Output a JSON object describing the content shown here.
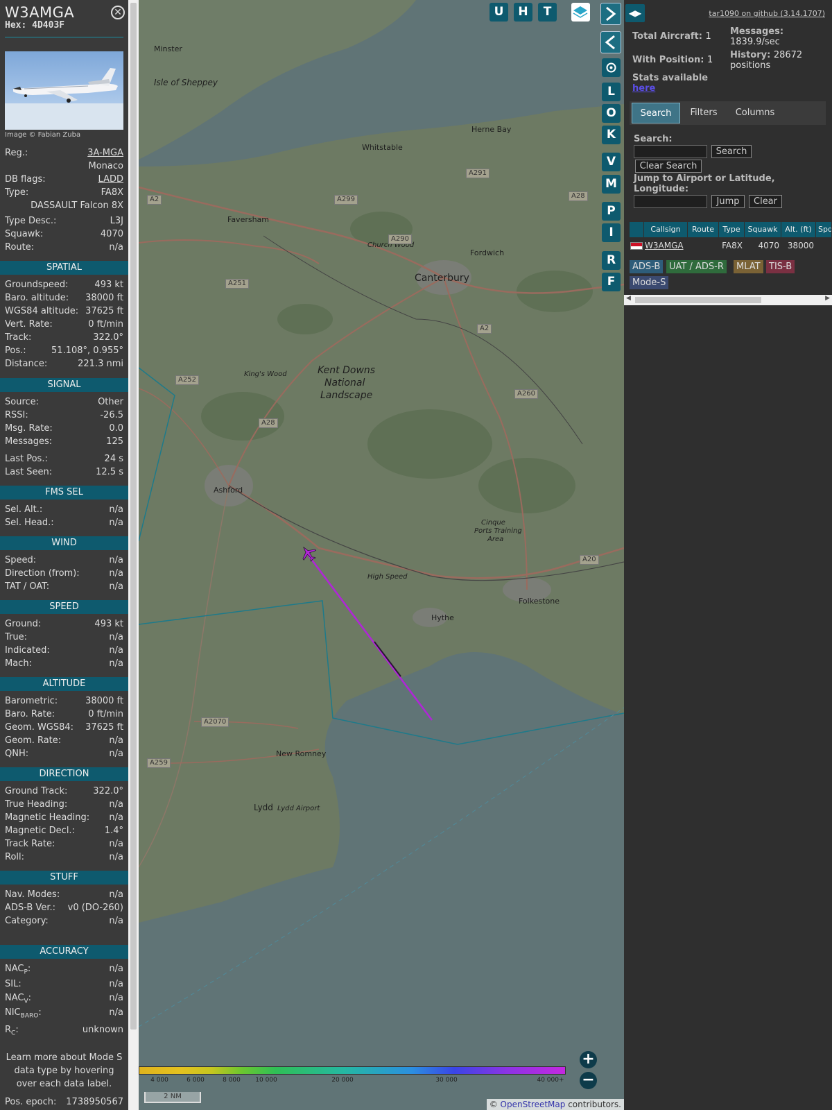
{
  "info": {
    "callsign": "W3AMGA",
    "hex": "Hex: 4D403F",
    "close_icon": "close-icon",
    "image_credit": "Image © Fabian Zuba",
    "reg_label": "Reg.:",
    "reg_value": "3A-MGA",
    "country": "Monaco",
    "dbflags_label": "DB flags:",
    "dbflags_value": "LADD",
    "type_label": "Type:",
    "type_value": "FA8X",
    "type_name": "DASSAULT Falcon 8X",
    "typedesc_label": "Type Desc.:",
    "typedesc_value": "L3J",
    "squawk_label": "Squawk:",
    "squawk_value": "4070",
    "route_label": "Route:",
    "route_value": "n/a"
  },
  "spatial": {
    "title": "SPATIAL",
    "rows": [
      {
        "k": "Groundspeed:",
        "v": "493 kt"
      },
      {
        "k": "Baro. altitude:",
        "v": "38000 ft"
      },
      {
        "k": "WGS84 altitude:",
        "v": "37625 ft"
      },
      {
        "k": "Vert. Rate:",
        "v": "0 ft/min"
      },
      {
        "k": "Track:",
        "v": "322.0°"
      },
      {
        "k": "Pos.:",
        "v": "51.108°, 0.955°"
      },
      {
        "k": "Distance:",
        "v": "221.3 nmi"
      }
    ]
  },
  "signal": {
    "title": "SIGNAL",
    "rows": [
      {
        "k": "Source:",
        "v": "Other"
      },
      {
        "k": "RSSI:",
        "v": "-26.5"
      },
      {
        "k": "Msg. Rate:",
        "v": "0.0"
      },
      {
        "k": "Messages:",
        "v": "125"
      },
      {
        "k": "Last Pos.:",
        "v": "24 s"
      },
      {
        "k": "Last Seen:",
        "v": "12.5 s"
      }
    ]
  },
  "fms": {
    "title": "FMS SEL",
    "rows": [
      {
        "k": "Sel. Alt.:",
        "v": "n/a"
      },
      {
        "k": "Sel. Head.:",
        "v": "n/a"
      }
    ]
  },
  "wind": {
    "title": "WIND",
    "rows": [
      {
        "k": "Speed:",
        "v": "n/a"
      },
      {
        "k": "Direction (from):",
        "v": "n/a"
      },
      {
        "k": "TAT / OAT:",
        "v": "n/a"
      }
    ]
  },
  "speed": {
    "title": "SPEED",
    "rows": [
      {
        "k": "Ground:",
        "v": "493 kt"
      },
      {
        "k": "True:",
        "v": "n/a"
      },
      {
        "k": "Indicated:",
        "v": "n/a"
      },
      {
        "k": "Mach:",
        "v": "n/a"
      }
    ]
  },
  "altitude": {
    "title": "ALTITUDE",
    "rows": [
      {
        "k": "Barometric:",
        "v": "38000 ft"
      },
      {
        "k": "Baro. Rate:",
        "v": "0 ft/min"
      },
      {
        "k": "Geom. WGS84:",
        "v": "37625 ft"
      },
      {
        "k": "Geom. Rate:",
        "v": "n/a"
      },
      {
        "k": "QNH:",
        "v": "n/a"
      }
    ]
  },
  "direction": {
    "title": "DIRECTION",
    "rows": [
      {
        "k": "Ground Track:",
        "v": "322.0°"
      },
      {
        "k": "True Heading:",
        "v": "n/a"
      },
      {
        "k": "Magnetic Heading:",
        "v": "n/a"
      },
      {
        "k": "Magnetic Decl.:",
        "v": "1.4°"
      },
      {
        "k": "Track Rate:",
        "v": "n/a"
      },
      {
        "k": "Roll:",
        "v": "n/a"
      }
    ]
  },
  "stuff": {
    "title": "STUFF",
    "rows": [
      {
        "k": "Nav. Modes:",
        "v": "n/a"
      },
      {
        "k": "ADS-B Ver.:",
        "v": "v0 (DO-260)"
      },
      {
        "k": "Category:",
        "v": "n/a"
      }
    ]
  },
  "accuracy": {
    "title": "ACCURACY",
    "nacp_k": "NAC",
    "nacp_sub": "P",
    "nacp_v": "n/a",
    "sil_k": "SIL:",
    "sil_v": "n/a",
    "nacv_k": "NAC",
    "nacv_sub": "V",
    "nacv_v": "n/a",
    "nicbaro_k": "NIC",
    "nicbaro_sub": "BARO",
    "nicbaro_v": "n/a",
    "rc_k": "R",
    "rc_sub": "C",
    "rc_v": "unknown"
  },
  "note": "Learn more about Mode S data type by hovering over each data label.",
  "posepoch": {
    "k": "Pos. epoch:",
    "v": "1738950567"
  },
  "map": {
    "buttons_top": [
      "U",
      "H",
      "T"
    ],
    "buttons_side": [
      "L",
      "O",
      "K",
      "V",
      "M",
      "P",
      "I",
      "R",
      "F"
    ],
    "places": [
      {
        "name": "Minster"
      },
      {
        "name": "Isle of Sheppey"
      },
      {
        "name": "Herne Bay"
      },
      {
        "name": "Whitstable"
      },
      {
        "name": "Faversham"
      },
      {
        "name": "Church Wood"
      },
      {
        "name": "Fordwich"
      },
      {
        "name": "Canterbury"
      },
      {
        "name": "Kent Downs"
      },
      {
        "name": "National"
      },
      {
        "name": "Landscape"
      },
      {
        "name": "King's Wood"
      },
      {
        "name": "Ashford"
      },
      {
        "name": "Cinque"
      },
      {
        "name": "Ports Training"
      },
      {
        "name": "Area"
      },
      {
        "name": "High Speed"
      },
      {
        "name": "Hythe"
      },
      {
        "name": "Folkestone"
      },
      {
        "name": "New Romney"
      },
      {
        "name": "Lydd"
      },
      {
        "name": "Lydd Airport"
      }
    ],
    "roads": [
      "A2",
      "A299",
      "A291",
      "A28",
      "A290",
      "A251",
      "A2",
      "A260",
      "A252",
      "A28",
      "A20",
      "A2070",
      "A259"
    ],
    "legend_ticks": [
      "4 000",
      "6 000",
      "8 000",
      "10 000",
      "20 000",
      "30 000",
      "40 000+"
    ],
    "scale": "2 NM",
    "attribution_prefix": "© ",
    "attribution_link": "OpenStreetMap",
    "attribution_suffix": " contributors."
  },
  "sidebar": {
    "github": "tar1090 on github (3.14.1707)",
    "total_label": "Total Aircraft:",
    "total_value": "1",
    "withpos_label": "With Position:",
    "withpos_value": "1",
    "stats_label": "Stats available",
    "stats_link": "here",
    "messages_label": "Messages:",
    "messages_value": "1839.9/sec",
    "history_label": "History:",
    "history_value": "28672 positions",
    "tabs": [
      "Search",
      "Filters",
      "Columns"
    ],
    "search_label": "Search:",
    "search_button": "Search",
    "clear_search_button": "Clear Search",
    "jump_label": "Jump to Airport or Latitude, Longitude:",
    "jump_button": "Jump",
    "clear_button": "Clear",
    "columns": [
      "Callsign",
      "Route",
      "Type",
      "Squawk",
      "Alt. (ft)",
      "Spd"
    ],
    "row": {
      "callsign": "W3AMGA",
      "type": "FA8X",
      "squawk": "4070",
      "alt": "38000"
    },
    "badges": [
      "ADS-B",
      "UAT / ADS-R",
      "MLAT",
      "TIS-B",
      "Mode-S"
    ]
  }
}
